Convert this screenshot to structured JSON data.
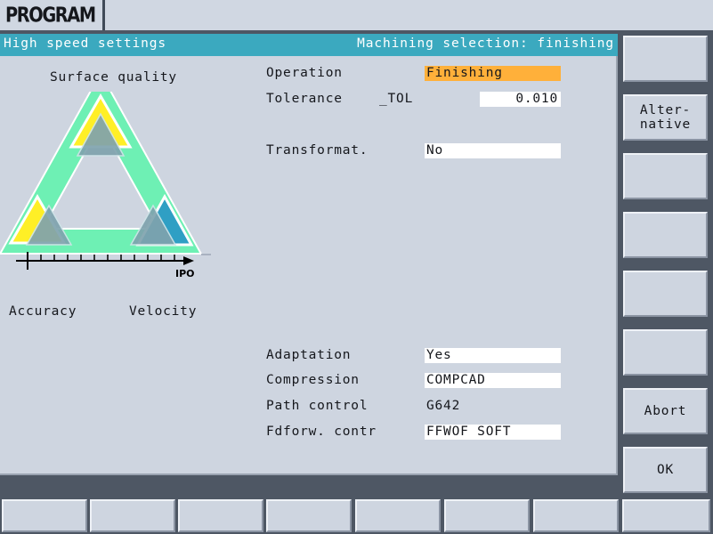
{
  "window": {
    "title": "PROGRAM"
  },
  "status": {
    "left": "High speed settings",
    "right": "Machining selection: finishing"
  },
  "graphic": {
    "title": "Surface quality",
    "left_label": "Accuracy",
    "right_label": "Velocity",
    "axis_label": "IPO",
    "colors": {
      "triangle_green": "#6ef0b4",
      "marker_yellow": "#ffef26",
      "marker_blue": "#2f9fc4",
      "marker_steel": "#7fa3ae",
      "axis": "#000000"
    },
    "axis_ticks": 11
  },
  "form": {
    "operation": {
      "label": "Operation",
      "value": "Finishing",
      "highlight": "#ffb03a"
    },
    "tolerance": {
      "label": "Tolerance",
      "sublabel": "_TOL",
      "value": "0.010"
    },
    "transformation": {
      "label": "Transformat.",
      "value": "No"
    },
    "adaptation": {
      "label": "Adaptation",
      "value": "Yes"
    },
    "compression": {
      "label": "Compression",
      "value": "COMPCAD"
    },
    "path_control": {
      "label": "Path control",
      "value": "G642"
    },
    "feedforward": {
      "label": "Fdforw. contr",
      "value": "FFWOF SOFT"
    }
  },
  "vertical_softkeys": [
    {
      "label": ""
    },
    {
      "label": "Alter-\nnative"
    },
    {
      "label": ""
    },
    {
      "label": ""
    },
    {
      "label": ""
    },
    {
      "label": ""
    },
    {
      "label": "Abort"
    },
    {
      "label": "OK"
    }
  ],
  "horizontal_softkeys": [
    {
      "label": ""
    },
    {
      "label": ""
    },
    {
      "label": ""
    },
    {
      "label": ""
    },
    {
      "label": ""
    },
    {
      "label": ""
    },
    {
      "label": ""
    },
    {
      "label": ""
    }
  ]
}
